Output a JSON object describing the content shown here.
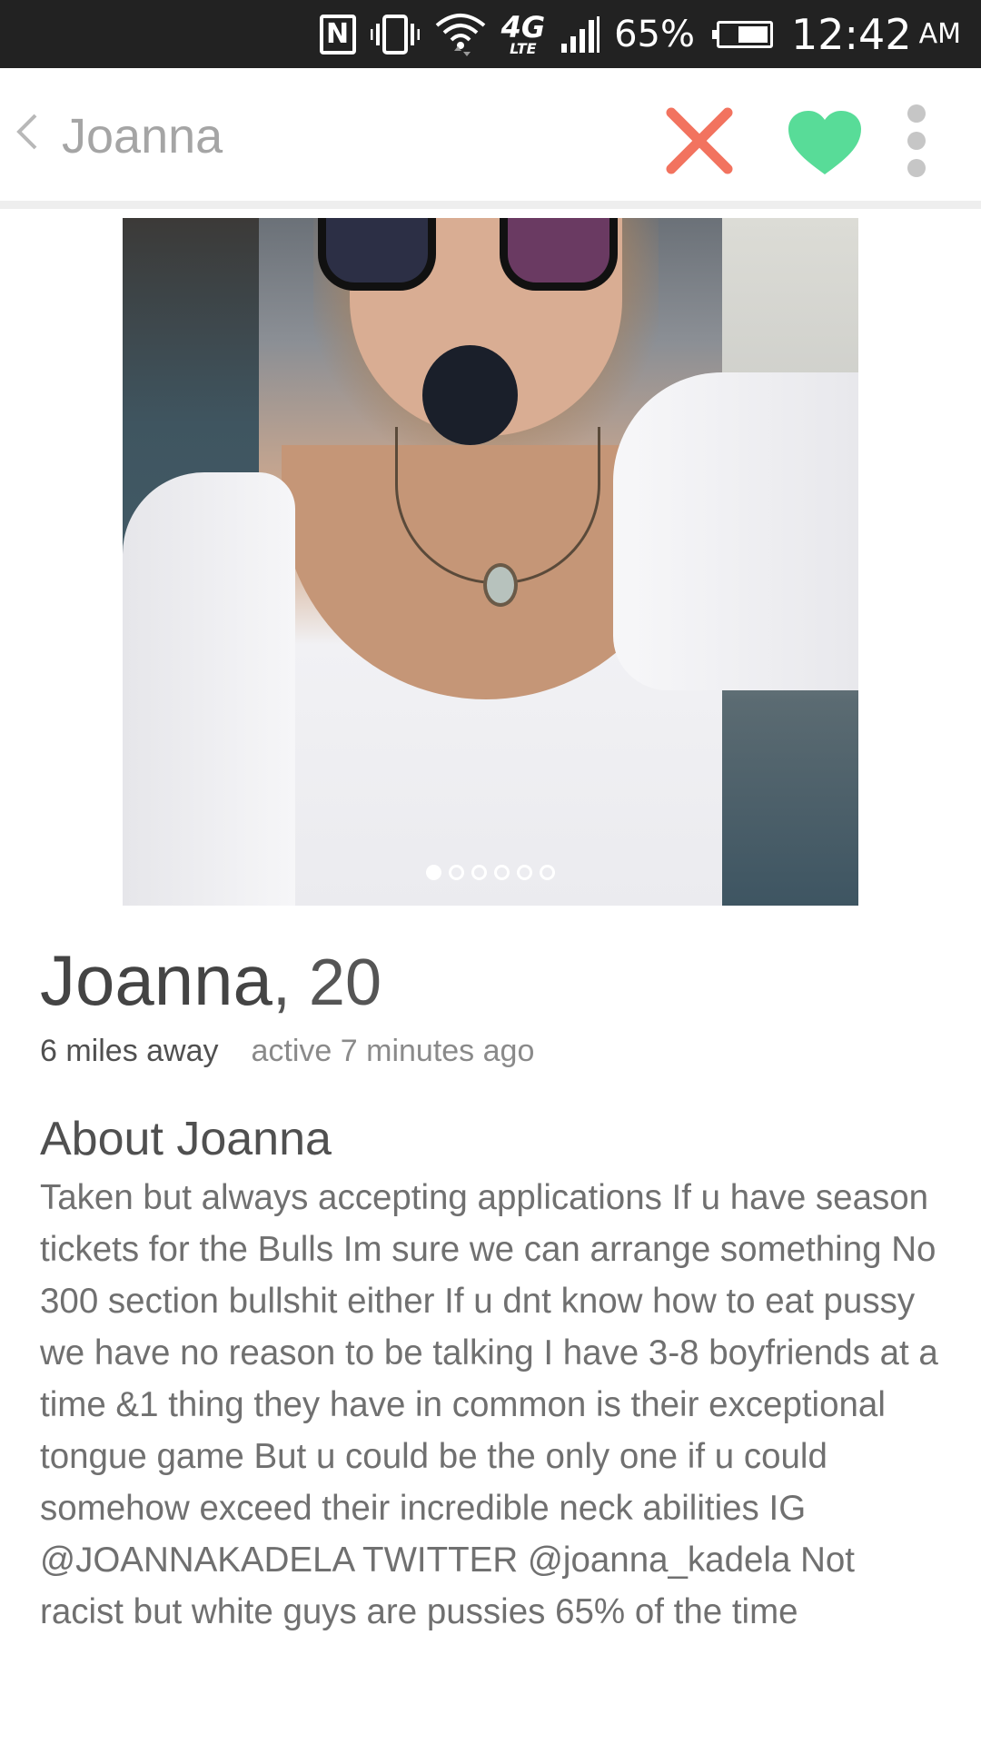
{
  "status_bar": {
    "network_label": "4G",
    "lte_label": "LTE",
    "battery_percent": "65%",
    "battery_level": 0.65,
    "time": "12:42",
    "ampm": "AM",
    "icons": [
      "nfc-icon",
      "vibrate-icon",
      "wifi-icon",
      "signal-icon",
      "battery-icon"
    ]
  },
  "header": {
    "back_icon": "chevron-left-icon",
    "title": "Joanna",
    "actions": [
      "close-icon",
      "heart-icon",
      "more-vert-icon"
    ],
    "colors": {
      "nope": "#f2735f",
      "like": "#58dc98",
      "more": "#c6c6c6"
    }
  },
  "photo": {
    "count": 6,
    "active_index": 0
  },
  "profile": {
    "name": "Joanna",
    "age": ", 20",
    "distance": "6 miles away",
    "active": "active 7 minutes ago"
  },
  "about": {
    "heading": "About Joanna",
    "bio": "Taken but always accepting applications If u have season tickets for the Bulls Im sure we can arrange something No 300 section bullshit either If u dnt know how to eat pussy we have no reason to be talking I have 3-8 boyfriends at a time &1 thing they have in common is their exceptional tongue game But u could be the only one if u could somehow exceed their incredible neck abilities IG @JOANNAKADELA TWITTER @joanna_kadela Not racist but white guys are pussies 65% of the time"
  }
}
